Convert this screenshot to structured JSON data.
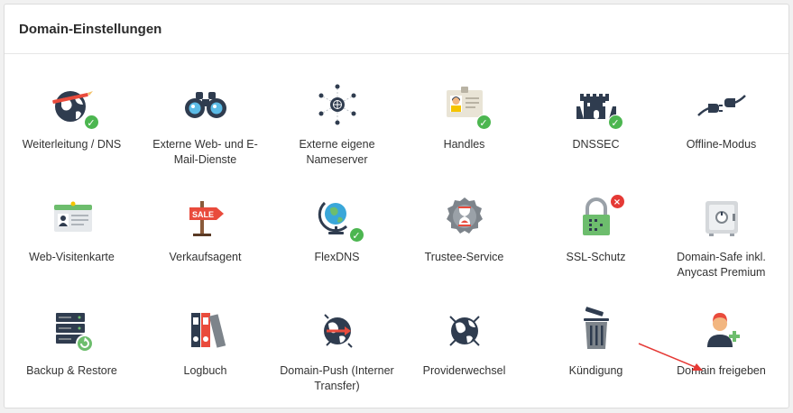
{
  "panel": {
    "title": "Domain-Einstellungen"
  },
  "colors": {
    "ok_badge": "#4cb650",
    "error_badge": "#e53935",
    "arrow": "#e53935"
  },
  "tiles": [
    {
      "label": "Weiterleitung / DNS",
      "icon": "globe-pencil-icon",
      "badge": "ok"
    },
    {
      "label": "Externe Web- und E-Mail-Dienste",
      "icon": "binoculars-icon"
    },
    {
      "label": "Externe eigene Nameserver",
      "icon": "network-nodes-icon"
    },
    {
      "label": "Handles",
      "icon": "id-badge-icon",
      "badge": "ok"
    },
    {
      "label": "DNSSEC",
      "icon": "castle-icon",
      "badge": "ok"
    },
    {
      "label": "Offline-Modus",
      "icon": "plug-icon"
    },
    {
      "label": "Web-Visitenkarte",
      "icon": "business-card-icon"
    },
    {
      "label": "Verkaufsagent",
      "icon": "sale-sign-icon",
      "sign_text": "SALE"
    },
    {
      "label": "FlexDNS",
      "icon": "desk-globe-icon",
      "badge": "ok"
    },
    {
      "label": "Trustee-Service",
      "icon": "hourglass-seal-icon"
    },
    {
      "label": "SSL-Schutz",
      "icon": "padlock-icon",
      "badge": "error"
    },
    {
      "label": "Domain-Safe inkl. Anycast Premium",
      "icon": "safe-icon"
    },
    {
      "label": "Backup & Restore",
      "icon": "server-restore-icon"
    },
    {
      "label": "Logbuch",
      "icon": "binders-icon"
    },
    {
      "label": "Domain-Push (Interner Transfer)",
      "icon": "globe-push-icon"
    },
    {
      "label": "Providerwechsel",
      "icon": "globe-switch-icon"
    },
    {
      "label": "Kündigung",
      "icon": "trash-can-icon"
    },
    {
      "label": "Domain freigeben",
      "icon": "user-add-icon"
    }
  ],
  "badges": {
    "ok": "✓",
    "error": "×"
  }
}
